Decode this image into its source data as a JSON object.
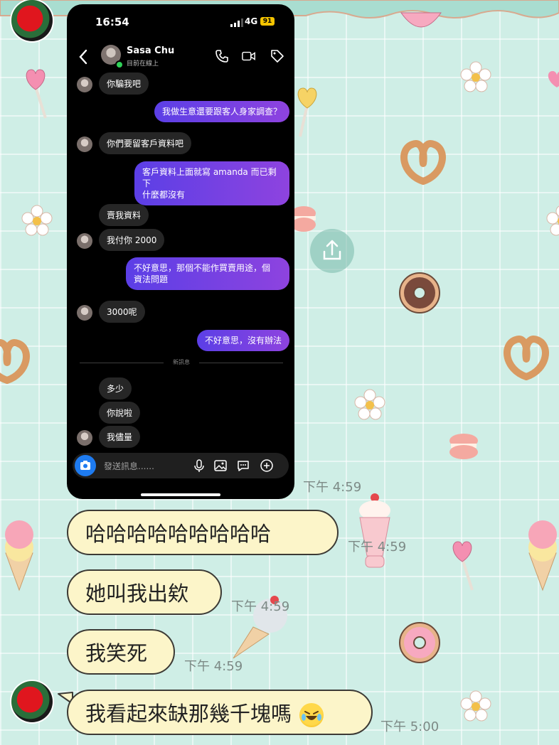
{
  "phone": {
    "status_time": "16:54",
    "network": "4G",
    "battery": "91",
    "contact_name": "Sasa Chu",
    "contact_status": "目前在線上",
    "messages": [
      {
        "dir": "in",
        "text": "你騙我吧"
      },
      {
        "dir": "out",
        "text": "我做生意還要跟客人身家調查？"
      },
      {
        "dir": "in",
        "text": "你們要留客戶資料吧"
      },
      {
        "dir": "out",
        "text": "客戶資料上面就寫 amanda 而已剩下",
        "text2": "什麼都沒有"
      },
      {
        "dir": "in",
        "text": "賣我資料"
      },
      {
        "dir": "in",
        "text": "我付你 2000"
      },
      {
        "dir": "out",
        "text": "不好意思，那個不能作買賣用途，個",
        "text2": "資法問題"
      },
      {
        "dir": "in",
        "text": "3000呢"
      },
      {
        "dir": "out",
        "text": "不好意思，沒有辦法"
      },
      {
        "dir": "in",
        "text": "多少"
      },
      {
        "dir": "in",
        "text": "你說啦"
      },
      {
        "dir": "in",
        "text": "我儘量"
      }
    ],
    "new_messages_label": "新訊息",
    "composer_placeholder": "發送訊息......"
  },
  "chat": [
    {
      "text": "哈哈哈哈哈哈哈哈哈",
      "time": "下午 4:59"
    },
    {
      "text": "她叫我出欸",
      "time": "下午 4:59"
    },
    {
      "text": "我笑死",
      "time": "下午 4:59"
    },
    {
      "text": "我看起來缺那幾千塊嗎",
      "time": "下午 5:00"
    }
  ],
  "screenshot_time": "下午 4:59",
  "colors": {
    "background": "#cfeee6",
    "bubble_fill": "#fcf5c9",
    "outgoing_gradient_start": "#5b3fe6",
    "outgoing_gradient_end": "#8e43df"
  }
}
